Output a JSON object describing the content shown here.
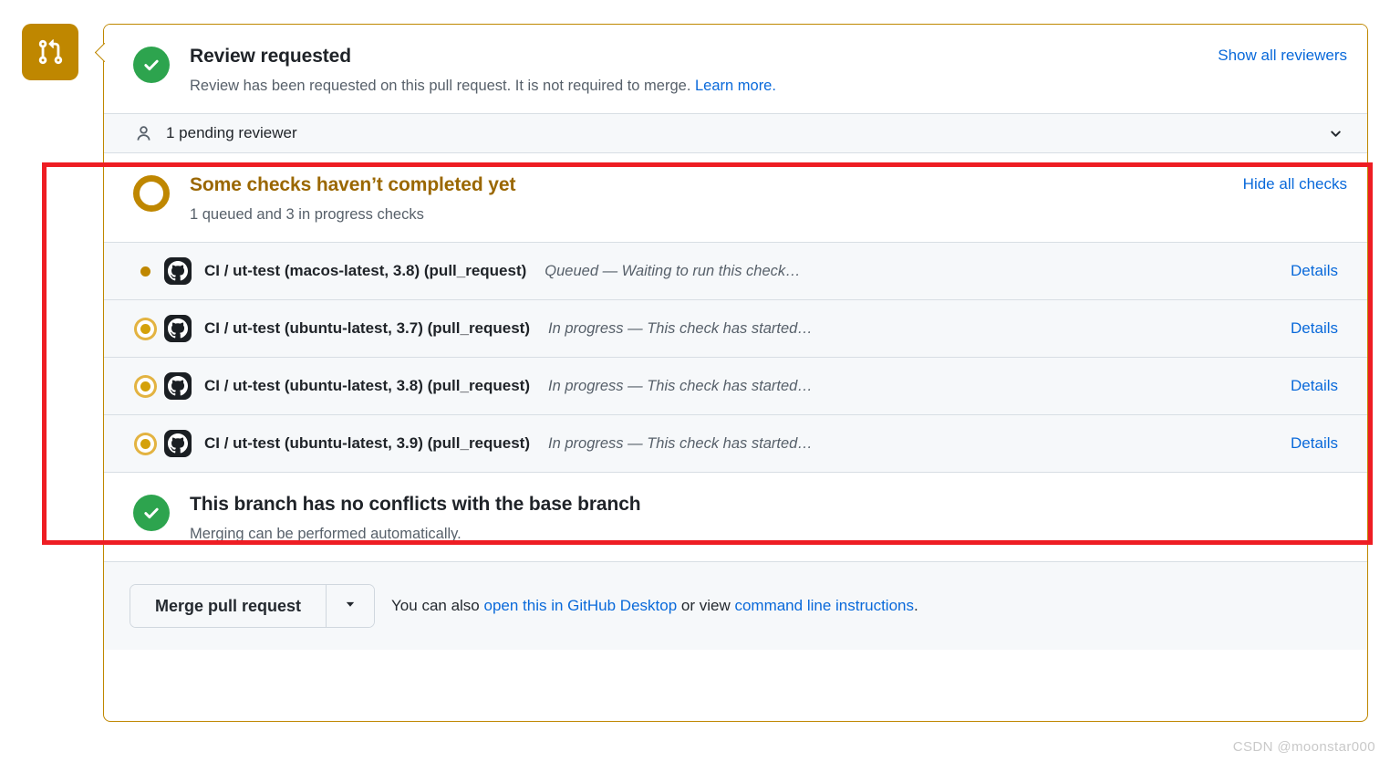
{
  "timeline": {
    "badge_icon": "git-pull-request-icon",
    "badge_color": "#bf8700"
  },
  "review_section": {
    "icon": "check-circle-icon",
    "title": "Review requested",
    "description_prefix": "Review has been requested on this pull request. It is not required to merge. ",
    "description_link": "Learn more.",
    "action_label": "Show all reviewers"
  },
  "reviewer_row": {
    "icon": "person-icon",
    "label": "1 pending reviewer",
    "chevron_icon": "chevron-down-icon"
  },
  "checks_section": {
    "icon": "pending-circle-icon",
    "title": "Some checks haven’t completed yet",
    "description": "1 queued and 3 in progress checks",
    "action_label": "Hide all checks",
    "details_label": "Details",
    "rows": [
      {
        "state": "queued",
        "avatar_icon": "github-actions-icon",
        "name": "CI / ut-test (macos-latest, 3.8) (pull_request)",
        "status": "Queued — Waiting to run this check…",
        "details": "Details"
      },
      {
        "state": "in_progress",
        "avatar_icon": "github-actions-icon",
        "name": "CI / ut-test (ubuntu-latest, 3.7) (pull_request)",
        "status": "In progress — This check has started…",
        "details": "Details"
      },
      {
        "state": "in_progress",
        "avatar_icon": "github-actions-icon",
        "name": "CI / ut-test (ubuntu-latest, 3.8) (pull_request)",
        "status": "In progress — This check has started…",
        "details": "Details"
      },
      {
        "state": "in_progress",
        "avatar_icon": "github-actions-icon",
        "name": "CI / ut-test (ubuntu-latest, 3.9) (pull_request)",
        "status": "In progress — This check has started…",
        "details": "Details"
      }
    ]
  },
  "conflict_section": {
    "icon": "check-circle-icon",
    "title": "This branch has no conflicts with the base branch",
    "description": "Merging can be performed automatically."
  },
  "merge_footer": {
    "merge_button_label": "Merge pull request",
    "caret_icon": "triangle-down-icon",
    "note_prefix": "You can also ",
    "note_link_1": "open this in GitHub Desktop",
    "note_middle": " or view ",
    "note_link_2": "command line instructions",
    "note_suffix": "."
  },
  "annotation": {
    "color": "#ee1d23"
  },
  "watermark": {
    "text": "CSDN @moonstar000"
  },
  "colors": {
    "success_green": "#2da44e",
    "pending_gold": "#bf8700",
    "link_blue": "#0969da",
    "card_border": "#bf8700",
    "row_bg": "#f6f8fa"
  }
}
